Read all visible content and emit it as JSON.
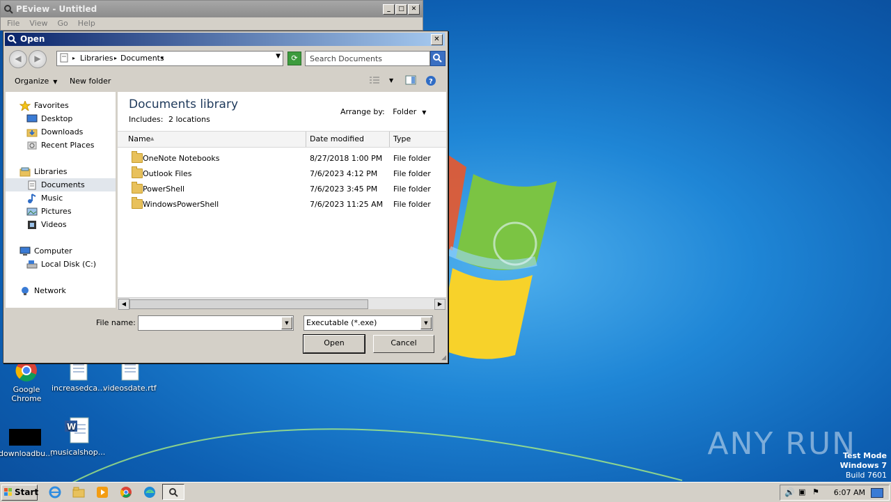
{
  "colors": {
    "desktop_bg": "#1a73c8",
    "title_active_start": "#0a246a",
    "title_active_end": "#a6caf0",
    "folder": "#e8c15c"
  },
  "peview": {
    "title": "PEview - Untitled",
    "menu": [
      "File",
      "View",
      "Go",
      "Help"
    ]
  },
  "dialog": {
    "title": "Open",
    "breadcrumb": [
      "Libraries",
      "Documents"
    ],
    "search_placeholder": "Search Documents",
    "toolbar": {
      "organize": "Organize",
      "new_folder": "New folder"
    },
    "nav": {
      "favorites": "Favorites",
      "desktop": "Desktop",
      "downloads": "Downloads",
      "recent_places": "Recent Places",
      "libraries": "Libraries",
      "documents": "Documents",
      "music": "Music",
      "pictures": "Pictures",
      "videos": "Videos",
      "computer": "Computer",
      "local_disk": "Local Disk (C:)",
      "network": "Network"
    },
    "library": {
      "title": "Documents library",
      "includes_label": "Includes:",
      "includes_link": "2 locations",
      "arrange_label": "Arrange by:",
      "arrange_value": "Folder"
    },
    "columns": {
      "name": "Name",
      "date_modified": "Date modified",
      "type": "Type"
    },
    "files": [
      {
        "name": "OneNote Notebooks",
        "date": "8/27/2018 1:00 PM",
        "type": "File folder"
      },
      {
        "name": "Outlook Files",
        "date": "7/6/2023 4:12 PM",
        "type": "File folder"
      },
      {
        "name": "PowerShell",
        "date": "7/6/2023 3:45 PM",
        "type": "File folder"
      },
      {
        "name": "WindowsPowerShell",
        "date": "7/6/2023 11:25 AM",
        "type": "File folder"
      }
    ],
    "file_name_label": "File name:",
    "file_name_value": "",
    "file_type": "Executable (*.exe)",
    "open_button": "Open",
    "cancel_button": "Cancel"
  },
  "desktop_icons": [
    {
      "label": "Google Chrome"
    },
    {
      "label": "increasedca..."
    },
    {
      "label": "videosdate.rtf"
    },
    {
      "label": "downloadbu..."
    },
    {
      "label": "musicalshop..."
    }
  ],
  "watermark": "ANY RUN",
  "test_mode": {
    "line1": "Test Mode",
    "line2": "Windows 7",
    "line3": "Build 7601"
  },
  "taskbar": {
    "start_label": "Start",
    "clock": "6:07 AM"
  }
}
